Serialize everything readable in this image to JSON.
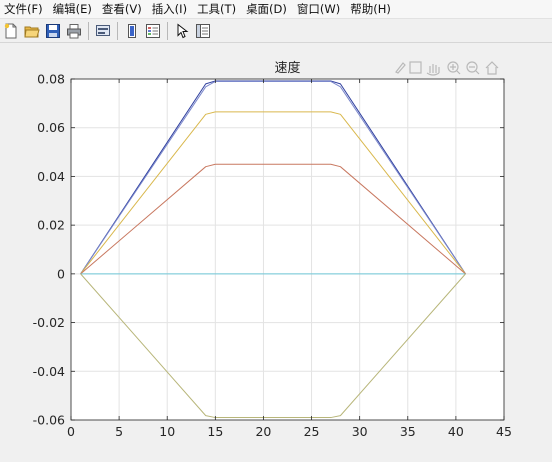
{
  "menu": {
    "items": [
      {
        "label": "文件(F)"
      },
      {
        "label": "编辑(E)"
      },
      {
        "label": "查看(V)"
      },
      {
        "label": "插入(I)"
      },
      {
        "label": "工具(T)"
      },
      {
        "label": "桌面(D)"
      },
      {
        "label": "窗口(W)"
      },
      {
        "label": "帮助(H)"
      }
    ]
  },
  "toolbar": {
    "buttons": [
      "new-figure-icon",
      "open-file-icon",
      "save-icon",
      "print-icon",
      "link-plot-icon",
      "insert-colorbar-icon",
      "insert-legend-icon",
      "edit-plot-arrow-icon",
      "property-inspector-icon"
    ]
  },
  "axes_toolbar": {
    "buttons": [
      "brush-icon",
      "data-tips-icon",
      "pan-hand-icon",
      "zoom-in-icon",
      "zoom-out-icon",
      "restore-view-home-icon"
    ]
  },
  "chart_data": {
    "type": "line",
    "title": "速度",
    "xlabel": "",
    "ylabel": "",
    "xlim": [
      0,
      45
    ],
    "ylim": [
      -0.06,
      0.08
    ],
    "xticks": [
      0,
      5,
      10,
      15,
      20,
      25,
      30,
      35,
      40,
      45
    ],
    "yticks": [
      -0.06,
      -0.04,
      -0.02,
      0,
      0.02,
      0.04,
      0.06,
      0.08
    ],
    "ytick_labels": [
      "-0.06",
      "-0.04",
      "-0.02",
      "0",
      "0.02",
      "0.04",
      "0.06",
      "0.08"
    ],
    "grid": true,
    "series": [
      {
        "color": "#2f3f9e",
        "x": [
          1,
          14,
          15,
          27,
          28,
          41
        ],
        "y": [
          0,
          0.078,
          0.0792,
          0.0792,
          0.078,
          0
        ]
      },
      {
        "color": "#7b88cc",
        "x": [
          1,
          14,
          15,
          27,
          28,
          41
        ],
        "y": [
          0,
          0.0768,
          0.079,
          0.079,
          0.0768,
          0
        ]
      },
      {
        "color": "#d9b84d",
        "x": [
          1,
          14,
          15,
          27,
          28,
          41
        ],
        "y": [
          0,
          0.0655,
          0.0665,
          0.0665,
          0.0655,
          0
        ]
      },
      {
        "color": "#c87860",
        "x": [
          1,
          14,
          15,
          27,
          28,
          41
        ],
        "y": [
          0,
          0.044,
          0.045,
          0.045,
          0.044,
          0
        ]
      },
      {
        "color": "#6fc7d8",
        "x": [
          1,
          41
        ],
        "y": [
          0,
          0
        ]
      },
      {
        "color": "#b8b67a",
        "x": [
          1,
          14,
          15,
          27,
          28,
          41
        ],
        "y": [
          0,
          -0.0582,
          -0.059,
          -0.059,
          -0.0582,
          0
        ]
      }
    ]
  }
}
